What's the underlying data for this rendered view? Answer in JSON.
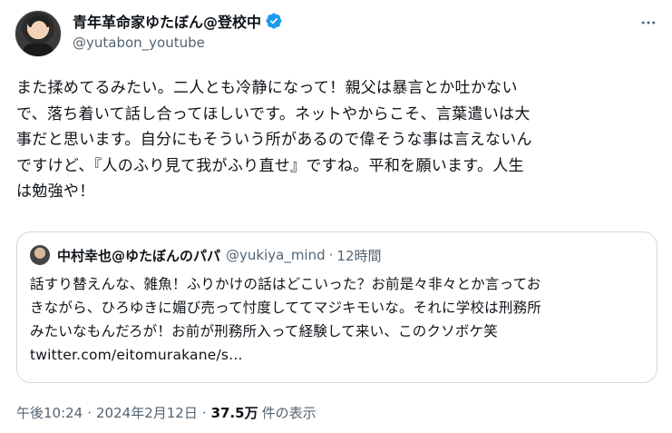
{
  "author": {
    "display_name": "青年革命家ゆたぼん@登校中",
    "handle": "@yutabon_youtube",
    "verified_icon": "verified-badge-icon",
    "badge_color": "#1d9bf0"
  },
  "tweet": {
    "lines": [
      "また揉めてるみたい。二人とも冷静になって！親父は暴言とか吐かない",
      "で、落ち着いて話し合ってほしいです。ネットやからこそ、言葉遣いは大",
      "事だと思います。自分にもそういう所があるので偉そうな事は言えないん",
      "ですけど、『人のふり見て我がふり直せ』ですね。平和を願います。人生",
      "は勉強や！"
    ]
  },
  "quote": {
    "display_name": "中村幸也@ゆたぼんのパパ",
    "handle": "@yukiya_mind",
    "separator": "·",
    "time": "12時間",
    "lines": [
      "話すり替えんな、雑魚！ふりかけの話はどこいった？お前是々非々とか言ってお",
      "きながら、ひろゆきに媚び売って忖度しててマジキモいな。それに学校は刑務所",
      "みたいなもんだろが！お前が刑務所入って経験して来い、このクソボケ笑",
      "twitter.com/eitomurakane/s..."
    ]
  },
  "meta": {
    "time": "午後10:24",
    "sep1": "·",
    "date": "2024年2月12日",
    "sep2": "·",
    "views_count": "37.5万",
    "views_label": "件の表示"
  }
}
